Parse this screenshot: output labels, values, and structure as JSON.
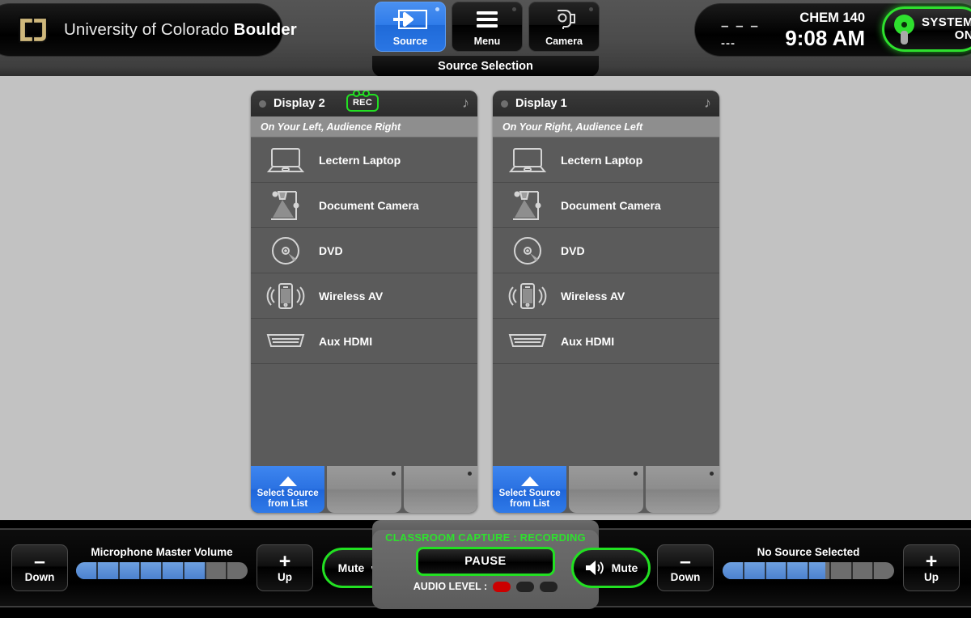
{
  "branding": {
    "logo_icon": "cu-monogram-icon",
    "university_prefix": "University of Colorado ",
    "university_bold": "Boulder"
  },
  "header": {
    "tabs": [
      {
        "label": "Source",
        "icon": "source-arrow-icon",
        "active": true
      },
      {
        "label": "Menu",
        "icon": "hamburger-menu-icon",
        "active": false
      },
      {
        "label": "Camera",
        "icon": "camera-icon",
        "active": false
      }
    ],
    "page_title": "Source Selection",
    "status": {
      "dash_top": "– – –",
      "dash_bottom": "---",
      "room": "CHEM 140",
      "time": "9:08 AM",
      "power_line1": "SYSTEM",
      "power_line2": "ON",
      "power_icon": "power-icon"
    }
  },
  "displays": [
    {
      "title": "Display 2",
      "badge": "REC",
      "badge_visible": true,
      "audio_icon": "music-note-icon",
      "subtitle": "On Your Left, Audience Right",
      "sources": [
        {
          "label": "Lectern Laptop",
          "icon": "laptop-icon"
        },
        {
          "label": "Document Camera",
          "icon": "document-camera-icon"
        },
        {
          "label": "DVD",
          "icon": "dvd-disc-icon"
        },
        {
          "label": "Wireless AV",
          "icon": "wireless-av-icon"
        },
        {
          "label": "Aux HDMI",
          "icon": "hdmi-connector-icon"
        }
      ],
      "footer": {
        "select_line1": "Select Source",
        "select_line2": "from List"
      }
    },
    {
      "title": "Display 1",
      "badge": "REC",
      "badge_visible": false,
      "audio_icon": "music-note-icon",
      "subtitle": "On Your Right, Audience Left",
      "sources": [
        {
          "label": "Lectern Laptop",
          "icon": "laptop-icon"
        },
        {
          "label": "Document Camera",
          "icon": "document-camera-icon"
        },
        {
          "label": "DVD",
          "icon": "dvd-disc-icon"
        },
        {
          "label": "Wireless AV",
          "icon": "wireless-av-icon"
        },
        {
          "label": "Aux HDMI",
          "icon": "hdmi-connector-icon"
        }
      ],
      "footer": {
        "select_line1": "Select Source",
        "select_line2": "from List"
      }
    }
  ],
  "bottom": {
    "mic": {
      "down_label": "Down",
      "down_glyph": "–",
      "title": "Microphone Master Volume",
      "level_percent": 76,
      "up_label": "Up",
      "up_glyph": "+",
      "mute_label": "Mute",
      "mute_icon": "microphone-icon"
    },
    "capture": {
      "title": "CLASSROOM CAPTURE : RECORDING",
      "pause_label": "PAUSE",
      "audio_level_label": "AUDIO LEVEL :",
      "audio_pills": [
        true,
        false,
        false
      ]
    },
    "program": {
      "mute_label": "Mute",
      "mute_icon": "speaker-icon",
      "down_label": "Down",
      "down_glyph": "–",
      "title": "No Source Selected",
      "level_percent": 60,
      "up_label": "Up",
      "up_glyph": "+"
    }
  },
  "colors": {
    "accent_blue": "#2f7cea",
    "status_green": "#22e022",
    "record_red": "#cc0000",
    "panel_gray": "#5b5b5b",
    "background_gray": "#c2c2c2"
  }
}
